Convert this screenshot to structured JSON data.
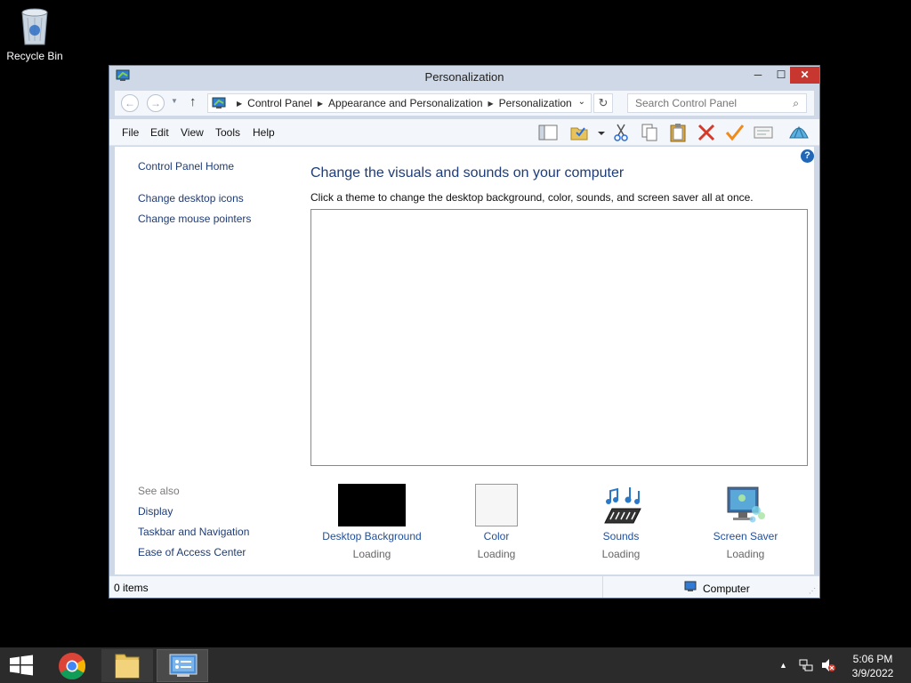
{
  "desktop": {
    "recycle_bin_label": "Recycle Bin"
  },
  "window": {
    "title": "Personalization",
    "controls": {
      "minimize": "─",
      "maximize": "☐",
      "close": "✕"
    },
    "breadcrumb": [
      "Control Panel",
      "Appearance and Personalization",
      "Personalization"
    ],
    "search_placeholder": "Search Control Panel",
    "menu": [
      "File",
      "Edit",
      "View",
      "Tools",
      "Help"
    ],
    "toolbar_icons": [
      "layout-icon",
      "folder-check-icon",
      "dropdown-arrow-icon",
      "cut-icon",
      "copy-icon",
      "paste-icon",
      "delete-icon",
      "check-icon",
      "properties-icon",
      "shell-icon"
    ]
  },
  "sidebar": {
    "home": "Control Panel Home",
    "links": [
      "Change desktop icons",
      "Change mouse pointers"
    ],
    "see_also_label": "See also",
    "see_also": [
      "Display",
      "Taskbar and Navigation",
      "Ease of Access Center"
    ]
  },
  "main": {
    "heading": "Change the visuals and sounds on your computer",
    "subtext": "Click a theme to change the desktop background, color, sounds, and screen saver all at once.",
    "tiles": [
      {
        "label": "Desktop Background",
        "status": "Loading"
      },
      {
        "label": "Color",
        "status": "Loading"
      },
      {
        "label": "Sounds",
        "status": "Loading"
      },
      {
        "label": "Screen Saver",
        "status": "Loading"
      }
    ]
  },
  "statusbar": {
    "items": "0 items",
    "location": "Computer"
  },
  "taskbar": {
    "time": "5:06 PM",
    "date": "3/9/2022"
  },
  "colors": {
    "link": "#1e3c78",
    "tile_link": "#1e4f9c",
    "close_button": "#c7372f",
    "window_frame": "#cfd8e6"
  }
}
